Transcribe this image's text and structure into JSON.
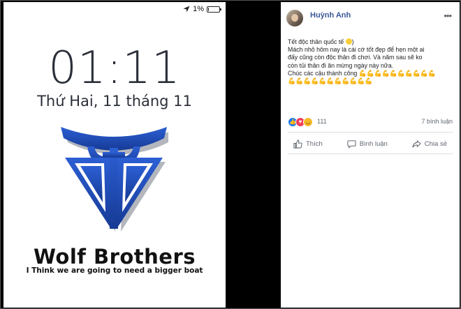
{
  "phone": {
    "status": {
      "battery_percent": "1%"
    },
    "time": "01:11",
    "date": "Thứ Hai, 11 tháng 11",
    "wallpaper": {
      "brand": "Wolf Brothers",
      "tagline": "I Think we are going to need a bigger boat",
      "logo_color": "#1e3f9e"
    }
  },
  "post": {
    "author": "Huỳnh Anh",
    "text_lines": [
      "Tết độc thân quốc tế",
      "Mách nhỏ hôm nay là cái cớ tốt đẹp để hẹn một ai",
      "đấy cũng còn độc thân đi chơi. Và năm sau sẽ ko",
      "còn tủi thân đi ăn mừng ngày này nữa.",
      "Chúc các cậu thành công"
    ],
    "reaction_count": "111",
    "comment_count": "7 bình luận",
    "actions": {
      "like": "Thích",
      "comment": "Bình luận",
      "share": "Chia sẻ"
    },
    "colors": {
      "author": "#385898",
      "like_blue": "#1877f2"
    }
  }
}
